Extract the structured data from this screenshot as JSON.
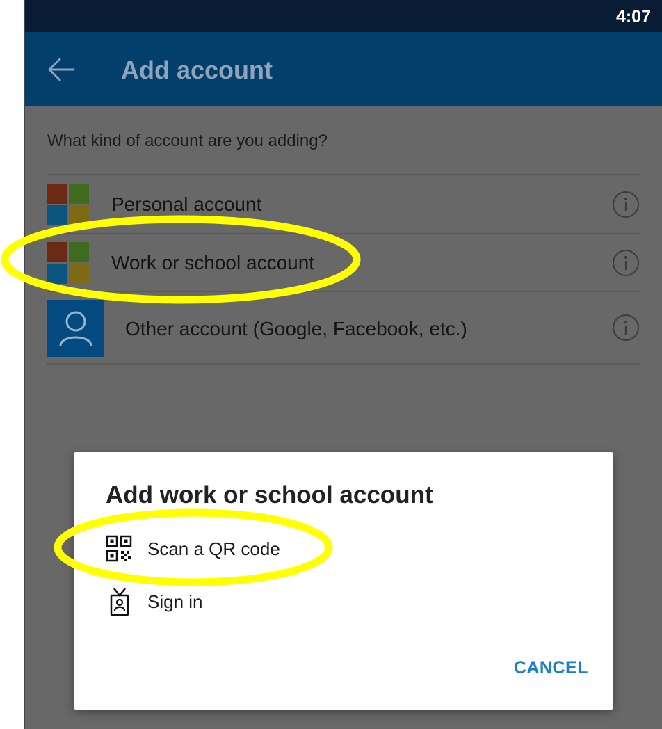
{
  "status_bar": {
    "time": "4:07"
  },
  "app_bar": {
    "back_icon": "arrow-left-icon",
    "title": "Add account"
  },
  "question": "What kind of account are you adding?",
  "accounts": [
    {
      "label": "Personal account",
      "icon": "microsoft-logo-icon",
      "info_icon": "info-icon"
    },
    {
      "label": "Work or school account",
      "icon": "microsoft-logo-icon",
      "info_icon": "info-icon"
    },
    {
      "label": "Other account (Google, Facebook, etc.)",
      "icon": "person-icon",
      "info_icon": "info-icon"
    }
  ],
  "dialog": {
    "title": "Add work or school account",
    "options": [
      {
        "label": "Scan a QR code",
        "icon": "qr-code-icon"
      },
      {
        "label": "Sign in",
        "icon": "badge-icon"
      }
    ],
    "cancel_label": "CANCEL"
  },
  "colors": {
    "status_bar": "#0a1c33",
    "app_bar": "#033f6b",
    "overlay_bg": "#686868",
    "accent": "#1a7fc4",
    "highlight": "#ffff00"
  }
}
